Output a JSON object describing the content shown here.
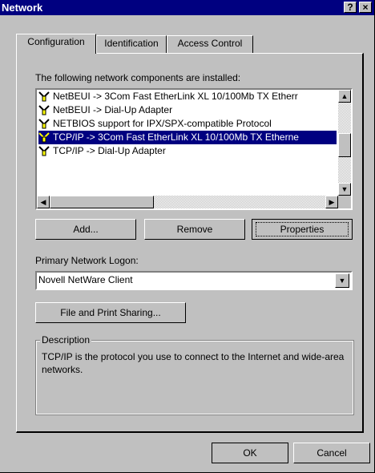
{
  "window": {
    "title": "Network"
  },
  "titlebar": {
    "help_label": "?",
    "close_label": "×"
  },
  "tabs": [
    {
      "label": "Configuration"
    },
    {
      "label": "Identification"
    },
    {
      "label": "Access Control"
    }
  ],
  "components": {
    "heading": "The following network components are installed:",
    "items": [
      {
        "label": "NetBEUI -> 3Com Fast EtherLink XL 10/100Mb TX Etherr",
        "selected": false
      },
      {
        "label": "NetBEUI -> Dial-Up Adapter",
        "selected": false
      },
      {
        "label": "NETBIOS support for IPX/SPX-compatible Protocol",
        "selected": false
      },
      {
        "label": "TCP/IP -> 3Com Fast EtherLink XL 10/100Mb TX Etherne",
        "selected": true
      },
      {
        "label": "TCP/IP -> Dial-Up Adapter",
        "selected": false
      }
    ]
  },
  "actions": {
    "add": "Add...",
    "remove": "Remove",
    "properties": "Properties"
  },
  "logon": {
    "label": "Primary Network Logon:",
    "value": "Novell NetWare Client"
  },
  "file_print_sharing": "File and Print Sharing...",
  "description": {
    "legend": "Description",
    "text": "TCP/IP is the protocol you use to connect to the Internet and wide-area networks."
  },
  "footer": {
    "ok": "OK",
    "cancel": "Cancel"
  },
  "colors": {
    "face": "#c0c0c0",
    "titlebar": "#000080",
    "selection": "#000080"
  }
}
